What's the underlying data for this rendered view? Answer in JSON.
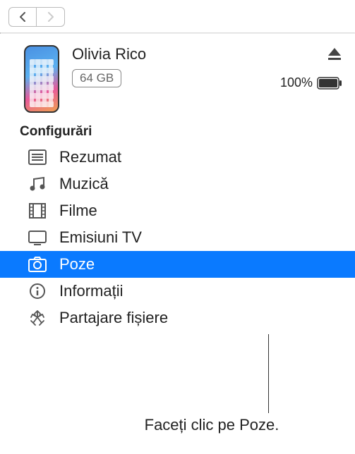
{
  "nav": {
    "back": "back",
    "forward": "forward"
  },
  "device": {
    "name": "Olivia Rico",
    "capacity": "64 GB",
    "battery_pct": "100%"
  },
  "section_label": "Configurări",
  "sidebar": {
    "items": [
      {
        "label": "Rezumat",
        "icon": "summary-icon",
        "selected": false
      },
      {
        "label": "Muzică",
        "icon": "music-icon",
        "selected": false
      },
      {
        "label": "Filme",
        "icon": "film-icon",
        "selected": false
      },
      {
        "label": "Emisiuni TV",
        "icon": "tv-icon",
        "selected": false
      },
      {
        "label": "Poze",
        "icon": "photos-icon",
        "selected": true
      },
      {
        "label": "Informații",
        "icon": "info-icon",
        "selected": false
      },
      {
        "label": "Partajare fișiere",
        "icon": "apps-icon",
        "selected": false
      }
    ]
  },
  "callout": "Faceți clic pe Poze."
}
